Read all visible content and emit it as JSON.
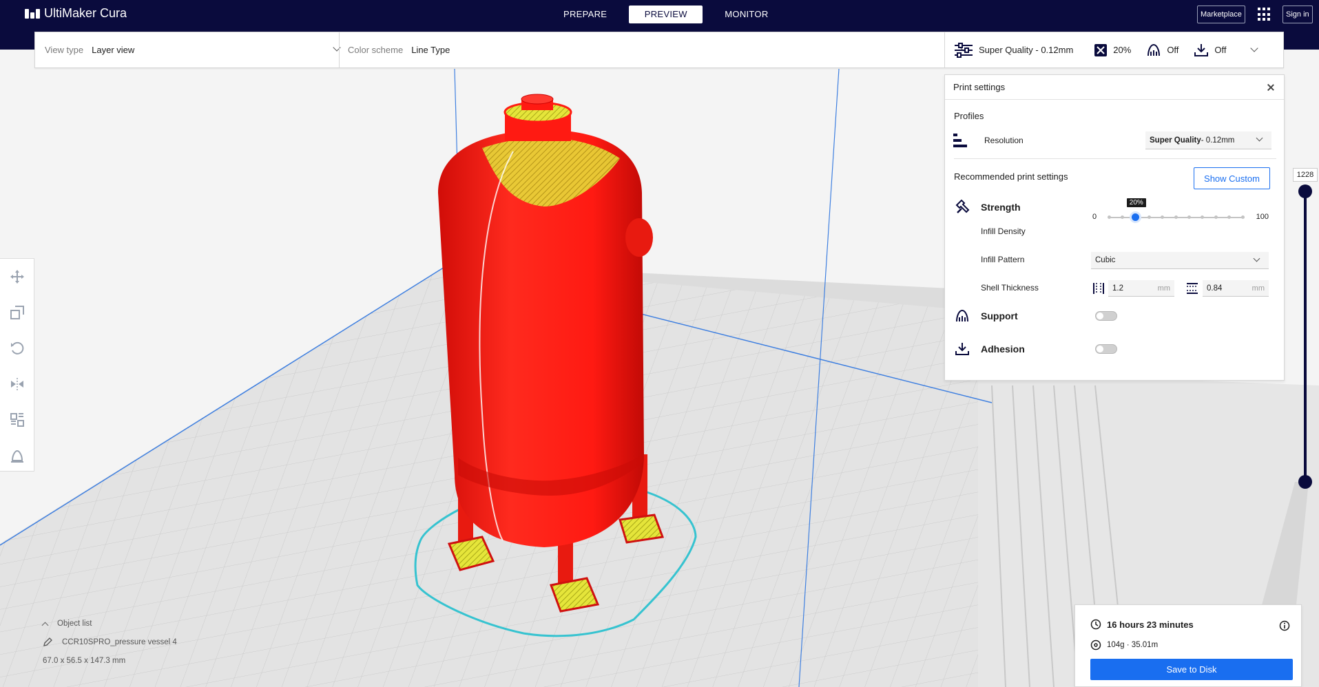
{
  "app": {
    "title": "UltiMaker Cura"
  },
  "stages": [
    {
      "label": "PREPARE",
      "active": false
    },
    {
      "label": "PREVIEW",
      "active": true
    },
    {
      "label": "MONITOR",
      "active": false
    }
  ],
  "header": {
    "marketplace_label": "Marketplace",
    "signin_label": "Sign in"
  },
  "toolbar": {
    "view_type_label": "View type",
    "view_type_value": "Layer view",
    "color_scheme_label": "Color scheme",
    "color_scheme_value": "Line Type",
    "profile_summary": "Super Quality - 0.12mm",
    "infill_summary": "20%",
    "support_summary": "Off",
    "adhesion_summary": "Off"
  },
  "print_settings": {
    "title": "Print settings",
    "profiles_label": "Profiles",
    "resolution_label": "Resolution",
    "resolution_value_bold": "Super Quality",
    "resolution_value_rest": " - 0.12mm",
    "recommended_label": "Recommended print settings",
    "show_custom_label": "Show Custom",
    "strength_label": "Strength",
    "infill_density_label": "Infill Density",
    "infill_min": "0",
    "infill_max": "100",
    "infill_value_label": "20%",
    "infill_value": 20,
    "infill_pattern_label": "Infill Pattern",
    "infill_pattern_value": "Cubic",
    "shell_thickness_label": "Shell Thickness",
    "wall_thickness": "1.2",
    "top_bottom_thickness": "0.84",
    "unit_mm": "mm",
    "support_label": "Support",
    "support_enabled": false,
    "adhesion_label": "Adhesion",
    "adhesion_enabled": false
  },
  "layer_slider": {
    "value": "1228"
  },
  "object_list": {
    "header": "Object list",
    "object_name": "CCR10SPRO_pressure vessel 4",
    "dimensions": "67.0 x 56.5 x 147.3 mm"
  },
  "estimate": {
    "time": "16 hours 23 minutes",
    "material": "104g · 35.01m",
    "save_label": "Save to Disk"
  },
  "colors": {
    "header_bg": "#0a0b3d",
    "accent": "#196ef0",
    "model_red": "#ff1a12",
    "infill_yellow": "#e5e53a",
    "skirt_cyan": "#36c3d0",
    "build_blue": "#3e7fe0"
  },
  "icons": {
    "tools": [
      "move-icon",
      "scale-icon",
      "rotate-icon",
      "mirror-icon",
      "per-model-settings-icon",
      "support-blocker-icon"
    ]
  }
}
